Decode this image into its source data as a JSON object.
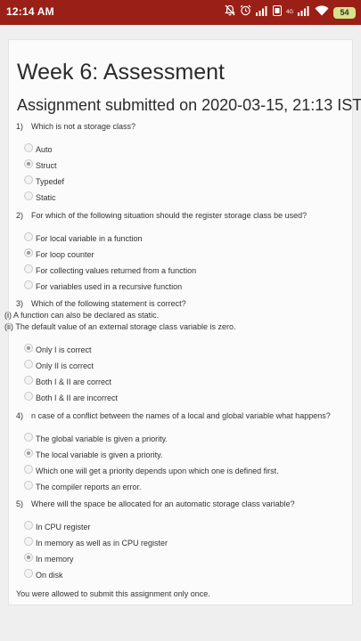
{
  "status_bar": {
    "time": "12:14 AM",
    "network_label": "4G",
    "battery": "54"
  },
  "page": {
    "title": "Week 6: Assessment",
    "submitted": "Assignment submitted on 2020-03-15, 21:13 IST",
    "footer": "You were allowed to submit this assignment only once."
  },
  "questions": [
    {
      "num": "1)",
      "text": "Which is not a storage class?",
      "options": [
        "Auto",
        "Struct",
        "Typedef",
        "Static"
      ],
      "selected_index": 1
    },
    {
      "num": "2)",
      "text": "For which of the following situation should the register storage class be used?",
      "options": [
        "For local variable in a function",
        "For loop counter",
        "For collecting values returned from a function",
        "For variables used in a recursive function"
      ],
      "selected_index": 1
    },
    {
      "num": "3)",
      "text": "Which of the following statement is correct?",
      "notes": [
        "(i) A function can also be declared as static.",
        "(ii) The default value of an external storage class variable is zero."
      ],
      "options": [
        "Only I is correct",
        "Only II is correct",
        "Both I & II are correct",
        "Both I & II are incorrect"
      ],
      "selected_index": 0
    },
    {
      "num": "4)",
      "text": "n case of a conflict between the names of a local and global variable what happens?",
      "options": [
        "The global variable is given a priority.",
        "The local variable is given a priority.",
        "Which one will get a priority depends upon which one is defined first.",
        "The compiler reports an error."
      ],
      "selected_index": 1
    },
    {
      "num": "5)",
      "text": "Where will the space be allocated for an automatic storage class variable?",
      "options": [
        "In CPU register",
        "In memory as well as in CPU register",
        "In memory",
        "On disk"
      ],
      "selected_index": 2
    }
  ]
}
